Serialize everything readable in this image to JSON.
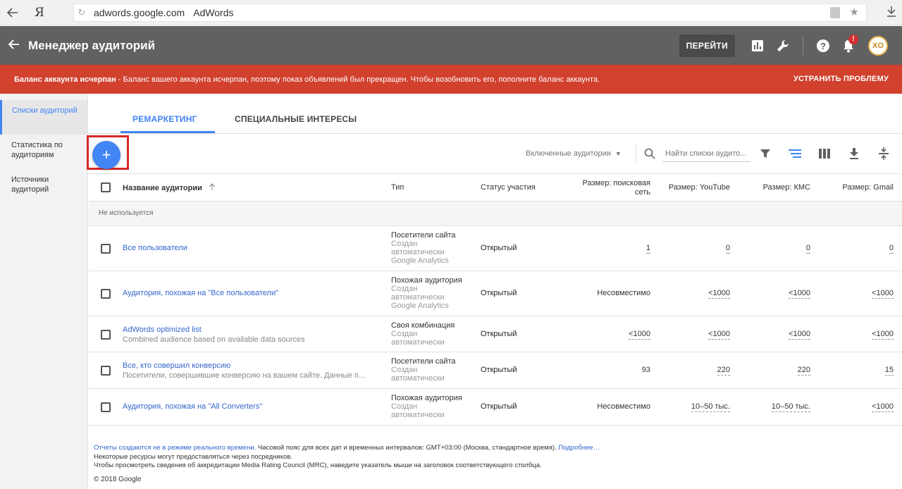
{
  "browser": {
    "domain": "adwords.google.com",
    "page_title": "AdWords",
    "yandex_label": "Я"
  },
  "header": {
    "title": "Менеджер аудиторий",
    "goto_label": "ПЕРЕЙТИ",
    "notification_count": "!",
    "avatar_text": "XO"
  },
  "alert": {
    "bold_text": "Баланс аккаунта исчерпан",
    "text": " - Баланс вашего аккаунта исчерпан, поэтому показ объявлений был прекращен. Чтобы возобновить его, пополните баланс аккаунта.",
    "fix_label": "УСТРАНИТЬ ПРОБЛЕМУ",
    "color": "#d1412e"
  },
  "sidebar": {
    "items": [
      {
        "label": "Списки аудиторий",
        "active": true
      },
      {
        "label": "Статистика по аудиториям",
        "active": false
      },
      {
        "label": "Источники аудиторий",
        "active": false
      }
    ]
  },
  "tabs": [
    {
      "label": "РЕМАРКЕТИНГ",
      "active": true
    },
    {
      "label": "СПЕЦИАЛЬНЫЕ ИНТЕРЕСЫ",
      "active": false
    }
  ],
  "toolbar": {
    "add_label": "+",
    "filter_label": "Включенные аудитории",
    "search_placeholder": "Найти списки аудито..."
  },
  "table": {
    "columns": {
      "name": "Название аудитории",
      "type": "Тип",
      "status": "Статус участия",
      "search_size": "Размер: поисковая сеть",
      "youtube_size": "Размер: YouTube",
      "kms_size": "Размер: КМС",
      "gmail_size": "Размер: Gmail"
    },
    "group_label": "Не используется",
    "rows": [
      {
        "name": "Все пользователи",
        "sub": "",
        "type": "Посетители сайта",
        "type_sub1": "Создан",
        "type_sub2": "автоматически",
        "type_sub3": "Google Analytics",
        "status": "Открытый",
        "search": "1",
        "youtube": "0",
        "kms": "0",
        "gmail": "0"
      },
      {
        "name": "Аудитория, похожая на \"Все пользователи\"",
        "sub": "",
        "type": "Похожая аудитория",
        "type_sub1": "Создан",
        "type_sub2": "автоматически",
        "type_sub3": "Google Analytics",
        "status": "Открытый",
        "search": "Несовместимо",
        "youtube": "<1000",
        "kms": "<1000",
        "gmail": "<1000"
      },
      {
        "name": "AdWords optimized list",
        "sub": "Combined audience based on available data sources",
        "type": "Своя комбинация",
        "type_sub1": "Создан",
        "type_sub2": "автоматически",
        "type_sub3": "",
        "status": "Открытый",
        "search": "<1000",
        "youtube": "<1000",
        "kms": "<1000",
        "gmail": "<1000"
      },
      {
        "name": "Все, кто совершил конверсию",
        "sub": "Посетители, совершившие конверсию на вашем сайте. Данные полу…",
        "type": "Посетители сайта",
        "type_sub1": "Создан",
        "type_sub2": "автоматически",
        "type_sub3": "",
        "status": "Открытый",
        "search": "93",
        "youtube": "220",
        "kms": "220",
        "gmail": "15"
      },
      {
        "name": "Аудитория, похожая на \"All Converters\"",
        "sub": "",
        "type": "Похожая аудитория",
        "type_sub1": "Создан",
        "type_sub2": "автоматически",
        "type_sub3": "",
        "status": "Открытый",
        "search": "Несовместимо",
        "youtube": "10–50 тыс.",
        "kms": "10–50 тыс.",
        "gmail": "<1000"
      }
    ]
  },
  "footer": {
    "line1_link": "Отчеты создаются не в режиме реального времени.",
    "line1_text": " Часовой пояс для всех дат и временных интервалов: GMT+03:00 (Москва, стандартное время). ",
    "line1_more": "Подробнее…",
    "line2": "Некоторые ресурсы могут предоставляться через посредников.",
    "line3": "Чтобы просмотреть сведения об аккредитации Media Rating Council (MRC), наведите указатель мыши на заголовок соответствующего столбца.",
    "copyright": "© 2018 Google"
  }
}
